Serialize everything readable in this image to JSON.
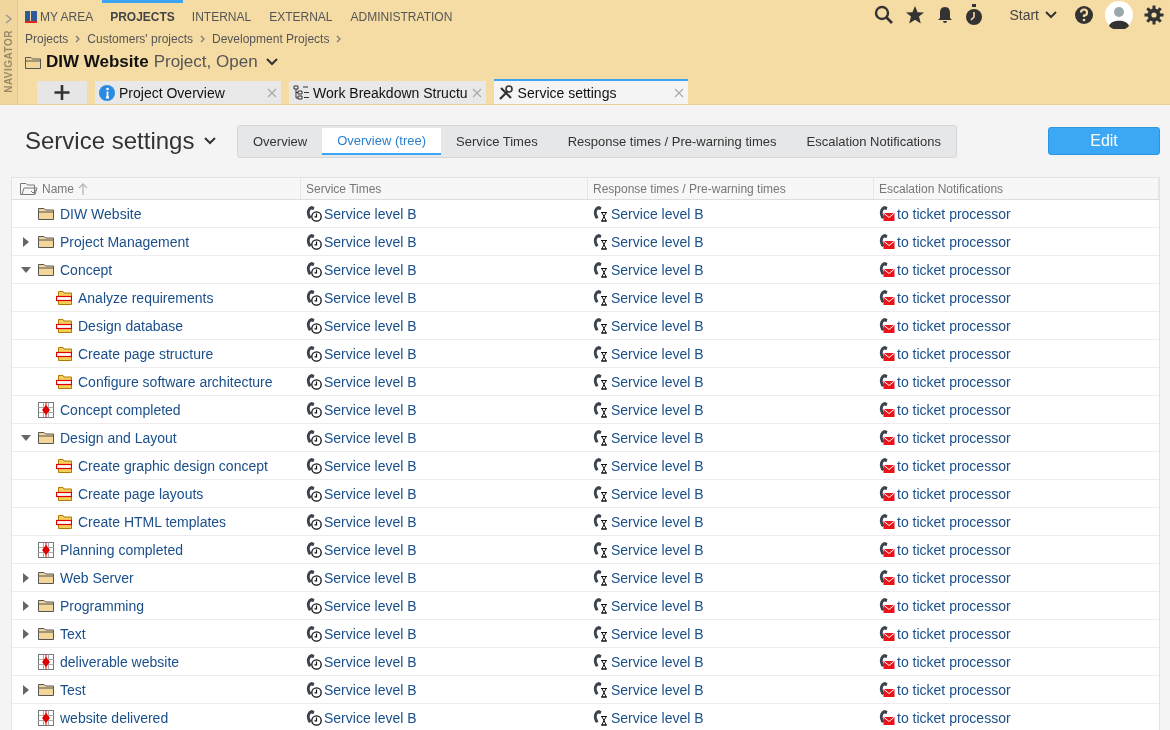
{
  "navigator": {
    "label": "NAVIGATOR"
  },
  "top_nav": [
    {
      "label": "MY AREA",
      "selected": false,
      "kind": "area"
    },
    {
      "label": "PROJECTS",
      "selected": true,
      "kind": "plain"
    },
    {
      "label": "INTERNAL",
      "selected": false,
      "kind": "plain"
    },
    {
      "label": "EXTERNAL",
      "selected": false,
      "kind": "plain"
    },
    {
      "label": "ADMINISTRATION",
      "selected": false,
      "kind": "plain"
    }
  ],
  "toolbar": {
    "start_menu": "Start"
  },
  "breadcrumbs": [
    "Projects",
    "Customers' projects",
    "Development Projects"
  ],
  "object": {
    "name": "DIW Website",
    "status": "Project, Open"
  },
  "doc_tabs": [
    {
      "label": "Project Overview",
      "kind": "info",
      "selected": false
    },
    {
      "label": "Work Breakdown Structu",
      "kind": "wbs",
      "selected": false
    },
    {
      "label": "Service settings",
      "kind": "tools",
      "selected": true
    }
  ],
  "page": {
    "title": "Service settings",
    "edit_button": "Edit"
  },
  "view_tabs": [
    {
      "label": "Overview",
      "selected": false
    },
    {
      "label": "Overview (tree)",
      "selected": true
    },
    {
      "label": "Service Times",
      "selected": false
    },
    {
      "label": "Response times / Pre-warning times",
      "selected": false
    },
    {
      "label": "Escalation Notifications",
      "selected": false
    }
  ],
  "table": {
    "columns": [
      "Name",
      "Service Times",
      "Response times / Pre-warning times",
      "Escalation Notifications"
    ],
    "rows": [
      {
        "kind": "project",
        "name": "DIW Website",
        "service": "Service level B",
        "response": "Service level B",
        "escalation": "to ticket processor",
        "children": [
          {
            "kind": "folder",
            "expanded": false,
            "name": "Project Management",
            "service": "Service level B",
            "response": "Service level B",
            "escalation": "to ticket processor"
          },
          {
            "kind": "folder",
            "expanded": true,
            "name": "Concept",
            "service": "Service level B",
            "response": "Service level B",
            "escalation": "to ticket processor",
            "children": [
              {
                "kind": "task",
                "name": "Analyze requirements",
                "service": "Service level B",
                "response": "Service level B",
                "escalation": "to ticket processor"
              },
              {
                "kind": "task",
                "name": "Design database",
                "service": "Service level B",
                "response": "Service level B",
                "escalation": "to ticket processor"
              },
              {
                "kind": "task",
                "name": "Create page structure",
                "service": "Service level B",
                "response": "Service level B",
                "escalation": "to ticket processor"
              },
              {
                "kind": "task",
                "name": "Configure software architecture",
                "service": "Service level B",
                "response": "Service level B",
                "escalation": "to ticket processor"
              }
            ]
          },
          {
            "kind": "milestone",
            "name": "Concept completed",
            "service": "Service level B",
            "response": "Service level B",
            "escalation": "to ticket processor"
          },
          {
            "kind": "folder",
            "expanded": true,
            "name": "Design and Layout",
            "service": "Service level B",
            "response": "Service level B",
            "escalation": "to ticket processor",
            "children": [
              {
                "kind": "task",
                "name": "Create graphic design concept",
                "service": "Service level B",
                "response": "Service level B",
                "escalation": "to ticket processor"
              },
              {
                "kind": "task",
                "name": "Create page layouts",
                "service": "Service level B",
                "response": "Service level B",
                "escalation": "to ticket processor"
              },
              {
                "kind": "task",
                "name": "Create HTML templates",
                "service": "Service level B",
                "response": "Service level B",
                "escalation": "to ticket processor"
              }
            ]
          },
          {
            "kind": "milestone",
            "name": "Planning completed",
            "service": "Service level B",
            "response": "Service level B",
            "escalation": "to ticket processor"
          },
          {
            "kind": "folder",
            "expanded": false,
            "name": "Web Server",
            "service": "Service level B",
            "response": "Service level B",
            "escalation": "to ticket processor"
          },
          {
            "kind": "folder",
            "expanded": false,
            "name": "Programming",
            "service": "Service level B",
            "response": "Service level B",
            "escalation": "to ticket processor"
          },
          {
            "kind": "folder",
            "expanded": false,
            "name": "Text",
            "service": "Service level B",
            "response": "Service level B",
            "escalation": "to ticket processor"
          },
          {
            "kind": "milestone",
            "name": "deliverable website",
            "service": "Service level B",
            "response": "Service level B",
            "escalation": "to ticket processor"
          },
          {
            "kind": "folder",
            "expanded": false,
            "name": "Test",
            "service": "Service level B",
            "response": "Service level B",
            "escalation": "to ticket processor"
          },
          {
            "kind": "milestone",
            "name": "website delivered",
            "service": "Service level B",
            "response": "Service level B",
            "escalation": "to ticket processor"
          }
        ]
      }
    ]
  }
}
